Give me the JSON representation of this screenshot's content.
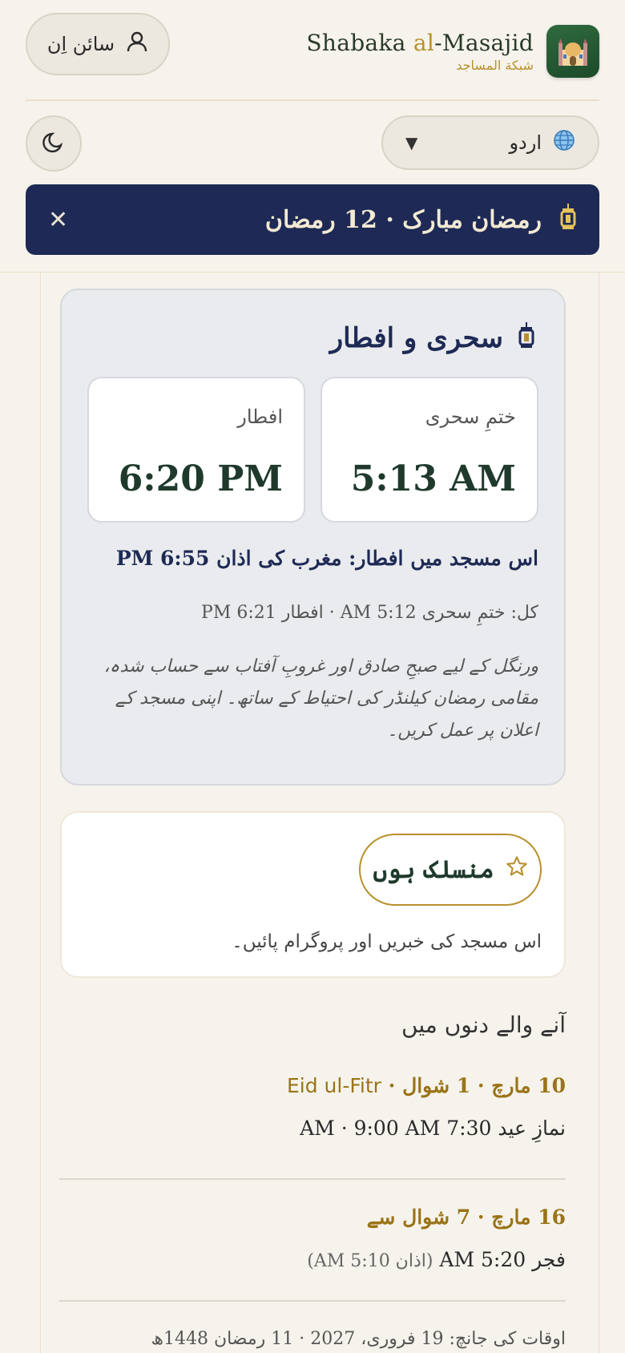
{
  "brand": {
    "name_part1": "Shabaka ",
    "name_accent": "al",
    "name_part2": "-Masajid",
    "subtitle": "شبكة المساجد"
  },
  "header": {
    "signin_label": "سائن اِن",
    "language_label": "اردو"
  },
  "banner": {
    "text": "رمضان مبارک · 12 رمضان",
    "close_label": "✕"
  },
  "sehri_iftar": {
    "title": "سحری و افطار",
    "sehri_label": "ختمِ سحری",
    "sehri_time": "5:13 AM",
    "iftar_label": "افطار",
    "iftar_time": "6:20 PM",
    "mosque_iftar": "اس مسجد میں افطار: مغرب کی اذان 6:55 PM",
    "tomorrow": "کل: ختمِ سحری 5:12 AM · افطار 6:21 PM",
    "note": "ورنگل کے لیے صبحِ صادق اور غروبِ آفتاب سے حساب شدہ، مقامی رمضان کیلنڈر کی احتیاط کے ساتھ۔ اپنی مسجد کے اعلان پر عمل کریں۔"
  },
  "follow": {
    "button_label": "منسلک ہوں",
    "description": "اس مسجد کی خبریں اور پروگرام پائیں۔"
  },
  "upcoming": {
    "title": "آنے والے دنوں میں",
    "events": [
      {
        "date": "10 مارچ · 1 شوال · ",
        "name": "Eid ul-Fitr",
        "detail": "نمازِ عید 7:30 AM · 9:00 AM",
        "sub": ""
      },
      {
        "date": "16 مارچ · 7 شوال سے",
        "name": "",
        "detail": "فجر 5:20 AM ",
        "sub": "(اذان 5:10 AM)"
      }
    ],
    "check_date": "اوقات کی جانچ: 19 فروری، 2027 · 11 رمضان 1448ھ"
  }
}
